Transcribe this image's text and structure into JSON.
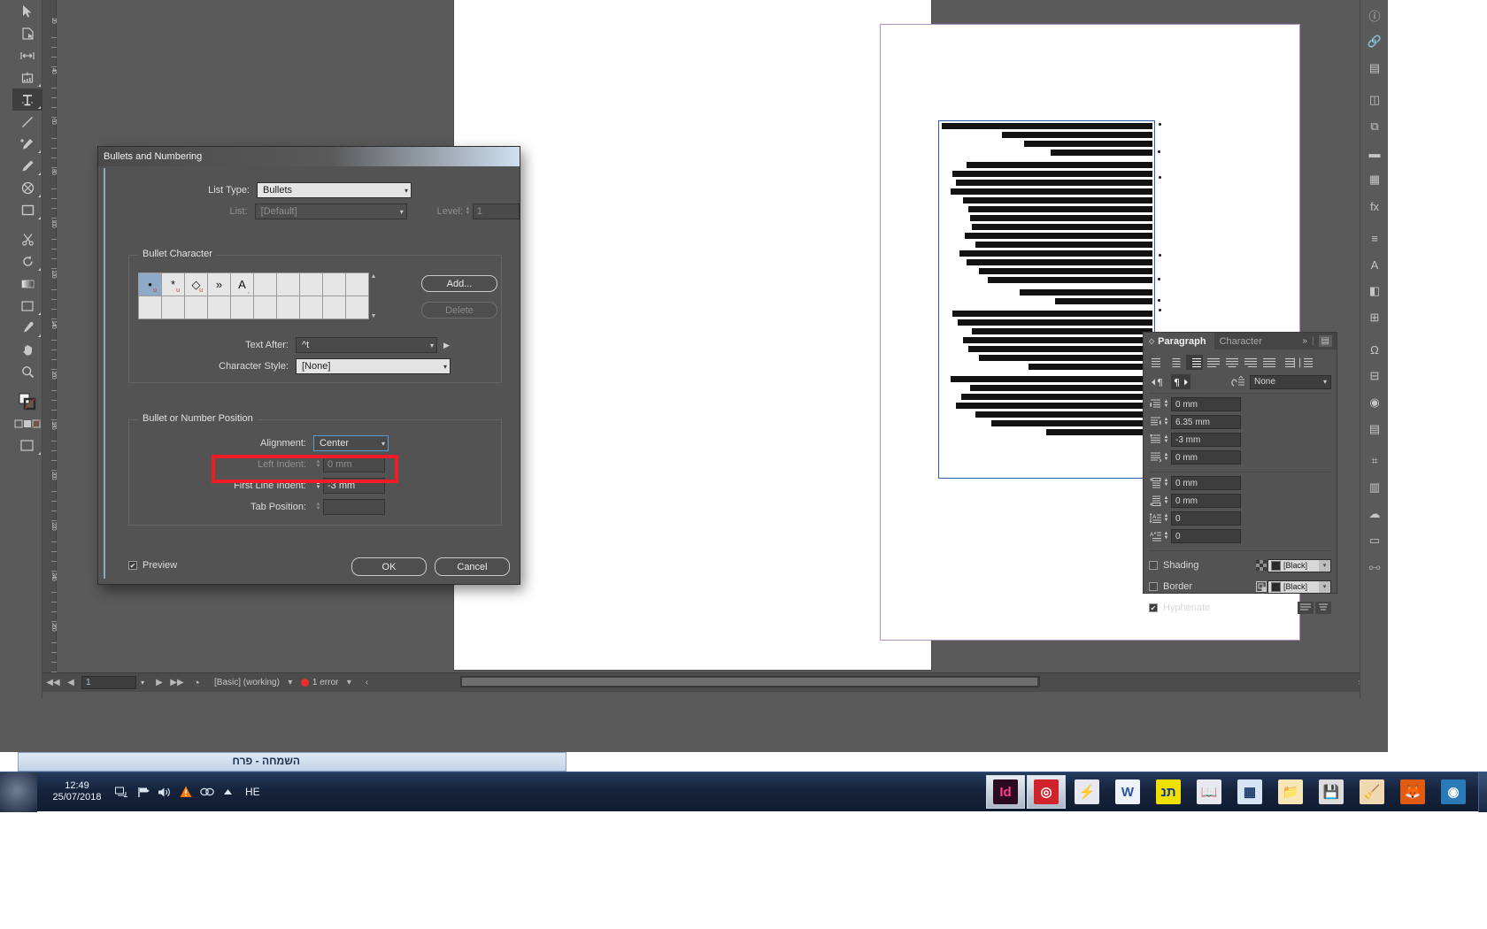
{
  "app": {
    "name": "Adobe InDesign"
  },
  "toolbar": {
    "tools": [
      {
        "name": "selection-tool",
        "glyph": "➤",
        "selected": false
      },
      {
        "name": "direct-selection-tool",
        "glyph": "◹",
        "selected": false
      },
      {
        "name": "gap-tool",
        "glyph": "|↔|",
        "selected": false
      },
      {
        "name": "page-tool",
        "glyph": "▣",
        "selected": false
      },
      {
        "name": "type-tool",
        "glyph": "T",
        "selected": true
      },
      {
        "name": "line-tool",
        "glyph": "╱",
        "selected": false
      },
      {
        "name": "pen-tool",
        "glyph": "✒",
        "selected": false
      },
      {
        "name": "pencil-tool",
        "glyph": "✏",
        "selected": false
      },
      {
        "name": "ellipse-frame-tool",
        "glyph": "⊗",
        "selected": false
      },
      {
        "name": "rectangle-tool",
        "glyph": "▢",
        "selected": false
      },
      {
        "name": "scissors-tool",
        "glyph": "✂",
        "selected": false
      },
      {
        "name": "free-transform-tool",
        "glyph": "↺",
        "selected": false
      },
      {
        "name": "gradient-swatch-tool",
        "glyph": "▤",
        "selected": false
      },
      {
        "name": "note-tool",
        "glyph": "▭",
        "selected": false
      },
      {
        "name": "eyedropper-tool",
        "glyph": "⌇",
        "selected": false
      },
      {
        "name": "hand-tool",
        "glyph": "✋",
        "selected": false
      },
      {
        "name": "zoom-tool",
        "glyph": "🔍",
        "selected": false
      }
    ]
  },
  "ruler": {
    "ticks": [
      "20",
      "40",
      "60",
      "80",
      "100",
      "120",
      "140",
      "160",
      "180",
      "200",
      "220",
      "240",
      "260"
    ]
  },
  "statusbar": {
    "first_page_icon": "◀◀",
    "prev_page_icon": "◀",
    "page_number": "1",
    "next_page_icon": "▶",
    "last_page_icon": "▶▶",
    "preflight_icon": "◔",
    "profile": "[Basic] (working)",
    "errors": "1 error",
    "nav_arrow_left": "‹",
    "nav_arrow_right": "›"
  },
  "dock": {
    "items": [
      {
        "name": "info-panel-icon",
        "glyph": "ⓘ"
      },
      {
        "name": "links-panel-icon",
        "glyph": "🔗"
      },
      {
        "name": "layers-panel-icon",
        "glyph": "▤"
      },
      {
        "name": "pages-panel-icon",
        "glyph": "◫"
      },
      {
        "name": "text-wrap-panel-icon",
        "glyph": "⧉"
      },
      {
        "name": "stroke-panel-icon",
        "glyph": "▬"
      },
      {
        "name": "swatches-panel-icon",
        "glyph": "▦"
      },
      {
        "name": "effects-panel-icon",
        "glyph": "fx"
      },
      {
        "name": "paragraph-styles-icon",
        "glyph": "≡"
      },
      {
        "name": "character-styles-icon",
        "glyph": "A"
      },
      {
        "name": "object-styles-icon",
        "glyph": "◧"
      },
      {
        "name": "table-panel-icon",
        "glyph": "⊞"
      },
      {
        "name": "glyphs-panel-icon",
        "glyph": "Ω"
      },
      {
        "name": "align-panel-icon",
        "glyph": "⊟"
      },
      {
        "name": "color-panel-icon",
        "glyph": "◉"
      },
      {
        "name": "articles-panel-icon",
        "glyph": "▤"
      },
      {
        "name": "tags-panel-icon",
        "glyph": "⌗"
      },
      {
        "name": "libraries-panel-icon",
        "glyph": "▥"
      },
      {
        "name": "cc-libraries-icon",
        "glyph": "☁"
      },
      {
        "name": "bookmarks-panel-icon",
        "glyph": "▭"
      },
      {
        "name": "hyperlinks-panel-icon",
        "glyph": "⧟"
      }
    ]
  },
  "dialog": {
    "title": "Bullets and Numbering",
    "list_type_label": "List Type:",
    "list_type_value": "Bullets",
    "list_label": "List:",
    "list_value": "[Default]",
    "level_label": "Level:",
    "level_value": "1",
    "bullet_character_group": "Bullet Character",
    "bullet_cells": [
      {
        "glyph": "•",
        "sub": "u",
        "selected": true
      },
      {
        "glyph": "*",
        "sub": "u",
        "selected": false
      },
      {
        "glyph": "◇",
        "sub": "u",
        "selected": false
      },
      {
        "glyph": "»",
        "sub": "",
        "selected": false
      },
      {
        "glyph": "A",
        "sub": "̦",
        "selected": false
      }
    ],
    "add_button": "Add...",
    "delete_button": "Delete",
    "text_after_label": "Text After:",
    "text_after_value": "^t",
    "character_style_label": "Character Style:",
    "character_style_value": "[None]",
    "position_group": "Bullet or Number Position",
    "alignment_label": "Alignment:",
    "alignment_value": "Center",
    "left_indent_label": "Left Indent:",
    "left_indent_value": "0 mm",
    "first_line_indent_label": "First Line Indent:",
    "first_line_indent_value": "-3 mm",
    "tab_position_label": "Tab Position:",
    "tab_position_value": "",
    "preview_label": "Preview",
    "preview_checked": true,
    "ok_button": "OK",
    "cancel_button": "Cancel",
    "highlight_color": "#ee1c25"
  },
  "paragraph_panel": {
    "tab_paragraph": "Paragraph",
    "tab_character": "Character",
    "overflow_icon": "»",
    "menu_icon": "▤",
    "grip_icon": "◇",
    "align_buttons": [
      {
        "name": "align-left",
        "active": false
      },
      {
        "name": "align-center",
        "active": false
      },
      {
        "name": "align-right",
        "active": true
      },
      {
        "name": "justify-last-left",
        "active": false
      },
      {
        "name": "justify-last-center",
        "active": false
      },
      {
        "name": "justify-last-right",
        "active": false
      },
      {
        "name": "justify-all",
        "active": false
      },
      {
        "name": "align-toward-spine",
        "active": false
      },
      {
        "name": "align-away-spine",
        "active": false
      }
    ],
    "direction_ltr": "▸¶",
    "direction_rtl": "¶◂",
    "direction_active": "rtl",
    "dropcap_label_value": "None",
    "left_indent": "0 mm",
    "right_indent": "6.35 mm",
    "first_line_left_indent": "-3 mm",
    "last_line_right_indent": "0 mm",
    "space_before": "0 mm",
    "space_after": "0 mm",
    "drop_cap_lines": "0",
    "drop_cap_chars": "0",
    "shading_label": "Shading",
    "shading_checked": false,
    "shading_color": "[Black]",
    "border_label": "Border",
    "border_checked": false,
    "border_color": "[Black]",
    "hyphenate_label": "Hyphenate",
    "hyphenate_checked": true
  },
  "desktop_window": {
    "title": "השמחה - פרח"
  },
  "taskbar": {
    "time": "12:49",
    "date": "25/07/2018",
    "language": "HE",
    "tray_icons": [
      {
        "name": "network-icon",
        "glyph": "🖧"
      },
      {
        "name": "action-center-icon",
        "glyph": "⚑"
      },
      {
        "name": "volume-icon",
        "glyph": "🔊"
      },
      {
        "name": "antivirus-icon",
        "glyph": "▲"
      },
      {
        "name": "link-icon",
        "glyph": "∞"
      },
      {
        "name": "show-hidden-icons-icon",
        "glyph": "▲"
      }
    ],
    "apps": [
      {
        "name": "indesign",
        "label": "Id",
        "bg": "#2b0a1f",
        "fg": "#ff3f8e",
        "active": true
      },
      {
        "name": "creative-cloud",
        "label": "◎",
        "bg": "#d0232b",
        "fg": "#ffffff",
        "active": true
      },
      {
        "name": "tracker",
        "label": "⚡",
        "bg": "#e8e8f0",
        "fg": "#2a2a6a",
        "active": false
      },
      {
        "name": "word",
        "label": "W",
        "bg": "#eef2fa",
        "fg": "#2b579a",
        "active": false
      },
      {
        "name": "hebrew-app",
        "label": "תנ",
        "bg": "#f0e000",
        "fg": "#1030a0",
        "active": false
      },
      {
        "name": "dictionary",
        "label": "📖",
        "bg": "#e8e8f0",
        "fg": "#202060",
        "active": false
      },
      {
        "name": "calculator",
        "label": "▦",
        "bg": "#d4e4f4",
        "fg": "#1a3a6a",
        "active": false
      },
      {
        "name": "folder",
        "label": "📁",
        "bg": "#f6e6b8",
        "fg": "#8a6a20",
        "active": false
      },
      {
        "name": "save-app",
        "label": "💾",
        "bg": "#dcdcdc",
        "fg": "#333333",
        "active": false
      },
      {
        "name": "ccleaner",
        "label": "🧹",
        "bg": "#f0d8b0",
        "fg": "#a03020",
        "active": false
      },
      {
        "name": "firefox",
        "label": "🦊",
        "bg": "#e05a10",
        "fg": "#ffffff",
        "active": false
      },
      {
        "name": "other-browser",
        "label": "◉",
        "bg": "#2a7ab8",
        "fg": "#ffffff",
        "active": false
      }
    ]
  }
}
